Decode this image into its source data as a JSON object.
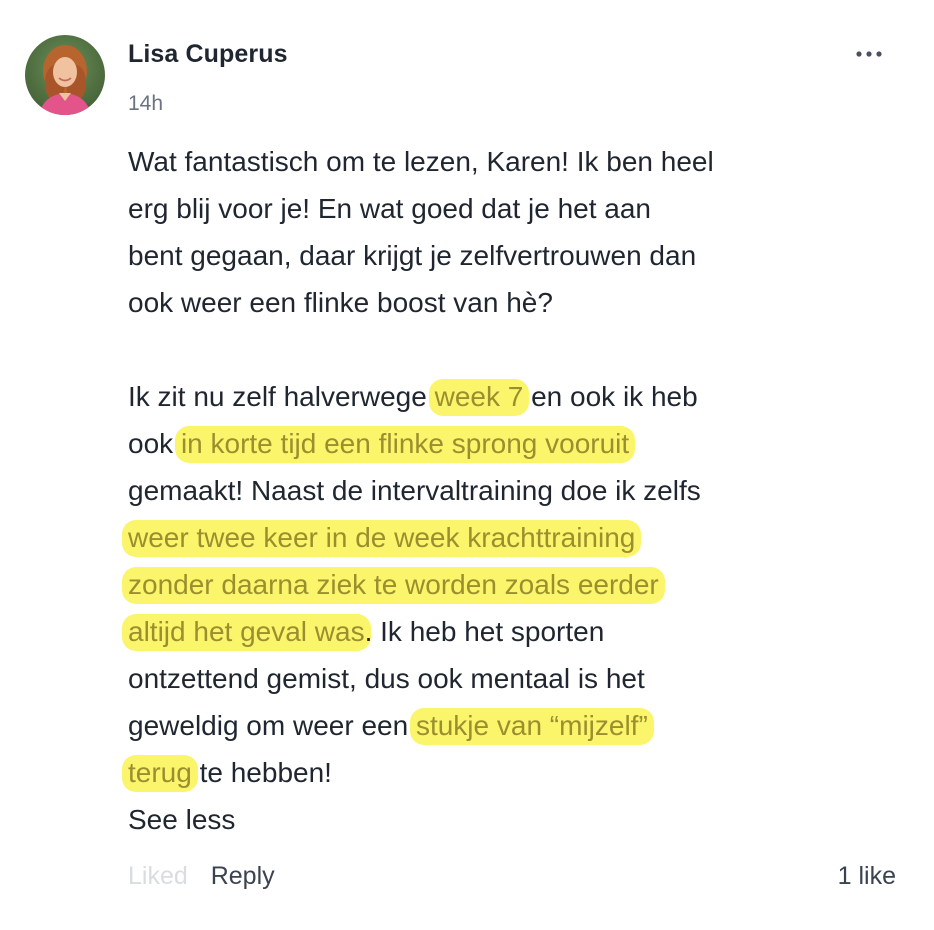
{
  "comment": {
    "author": "Lisa Cuperus",
    "time": "14h",
    "more_icon": "more-horizontal-icon",
    "highlight_color": "#fbf56b",
    "highlight_text_color": "#9a8f2f",
    "paragraph1": {
      "line1": "Wat fantastisch om te lezen, Karen! Ik ben heel",
      "line2": "erg blij voor je! En wat goed dat je het aan",
      "line3": "bent gegaan, daar krijgt je zelfvertrouwen dan",
      "line4": "ook weer een flinke boost van hè?"
    },
    "paragraph2": {
      "l1_a": "Ik zit nu zelf halverwege ",
      "l1_hl": "week 7",
      "l1_b": " en ook ik heb",
      "l2_a": "ook ",
      "l2_hl": "in korte tijd een flinke sprong vooruit",
      "l3": "gemaakt! Naast de intervaltraining doe ik zelfs",
      "l4_hl": "weer twee keer in de week krachttraining",
      "l5_hl": "zonder daarna ziek te worden zoals eerder",
      "l6_hl": "altijd het geval was",
      "l6_b": ". Ik heb het sporten",
      "l7": "ontzettend gemist, dus ook mentaal is het",
      "l8_a": "geweldig om weer een ",
      "l8_hl": "stukje van “mijzelf”",
      "l9_hl": "terug",
      "l9_b": " te hebben!"
    },
    "see_less": "See less",
    "actions": {
      "liked": "Liked",
      "reply": "Reply",
      "likes": "1 like"
    }
  }
}
